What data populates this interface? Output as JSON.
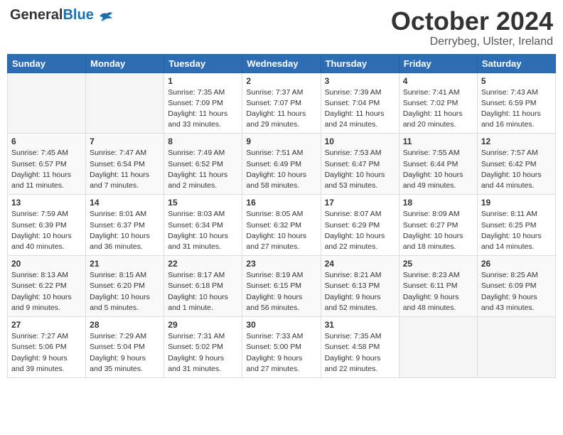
{
  "header": {
    "logo_general": "General",
    "logo_blue": "Blue",
    "title": "October 2024",
    "location": "Derrybeg, Ulster, Ireland"
  },
  "days_of_week": [
    "Sunday",
    "Monday",
    "Tuesday",
    "Wednesday",
    "Thursday",
    "Friday",
    "Saturday"
  ],
  "weeks": [
    [
      {
        "day": "",
        "sunrise": "",
        "sunset": "",
        "daylight": ""
      },
      {
        "day": "",
        "sunrise": "",
        "sunset": "",
        "daylight": ""
      },
      {
        "day": "1",
        "sunrise": "Sunrise: 7:35 AM",
        "sunset": "Sunset: 7:09 PM",
        "daylight": "Daylight: 11 hours and 33 minutes."
      },
      {
        "day": "2",
        "sunrise": "Sunrise: 7:37 AM",
        "sunset": "Sunset: 7:07 PM",
        "daylight": "Daylight: 11 hours and 29 minutes."
      },
      {
        "day": "3",
        "sunrise": "Sunrise: 7:39 AM",
        "sunset": "Sunset: 7:04 PM",
        "daylight": "Daylight: 11 hours and 24 minutes."
      },
      {
        "day": "4",
        "sunrise": "Sunrise: 7:41 AM",
        "sunset": "Sunset: 7:02 PM",
        "daylight": "Daylight: 11 hours and 20 minutes."
      },
      {
        "day": "5",
        "sunrise": "Sunrise: 7:43 AM",
        "sunset": "Sunset: 6:59 PM",
        "daylight": "Daylight: 11 hours and 16 minutes."
      }
    ],
    [
      {
        "day": "6",
        "sunrise": "Sunrise: 7:45 AM",
        "sunset": "Sunset: 6:57 PM",
        "daylight": "Daylight: 11 hours and 11 minutes."
      },
      {
        "day": "7",
        "sunrise": "Sunrise: 7:47 AM",
        "sunset": "Sunset: 6:54 PM",
        "daylight": "Daylight: 11 hours and 7 minutes."
      },
      {
        "day": "8",
        "sunrise": "Sunrise: 7:49 AM",
        "sunset": "Sunset: 6:52 PM",
        "daylight": "Daylight: 11 hours and 2 minutes."
      },
      {
        "day": "9",
        "sunrise": "Sunrise: 7:51 AM",
        "sunset": "Sunset: 6:49 PM",
        "daylight": "Daylight: 10 hours and 58 minutes."
      },
      {
        "day": "10",
        "sunrise": "Sunrise: 7:53 AM",
        "sunset": "Sunset: 6:47 PM",
        "daylight": "Daylight: 10 hours and 53 minutes."
      },
      {
        "day": "11",
        "sunrise": "Sunrise: 7:55 AM",
        "sunset": "Sunset: 6:44 PM",
        "daylight": "Daylight: 10 hours and 49 minutes."
      },
      {
        "day": "12",
        "sunrise": "Sunrise: 7:57 AM",
        "sunset": "Sunset: 6:42 PM",
        "daylight": "Daylight: 10 hours and 44 minutes."
      }
    ],
    [
      {
        "day": "13",
        "sunrise": "Sunrise: 7:59 AM",
        "sunset": "Sunset: 6:39 PM",
        "daylight": "Daylight: 10 hours and 40 minutes."
      },
      {
        "day": "14",
        "sunrise": "Sunrise: 8:01 AM",
        "sunset": "Sunset: 6:37 PM",
        "daylight": "Daylight: 10 hours and 36 minutes."
      },
      {
        "day": "15",
        "sunrise": "Sunrise: 8:03 AM",
        "sunset": "Sunset: 6:34 PM",
        "daylight": "Daylight: 10 hours and 31 minutes."
      },
      {
        "day": "16",
        "sunrise": "Sunrise: 8:05 AM",
        "sunset": "Sunset: 6:32 PM",
        "daylight": "Daylight: 10 hours and 27 minutes."
      },
      {
        "day": "17",
        "sunrise": "Sunrise: 8:07 AM",
        "sunset": "Sunset: 6:29 PM",
        "daylight": "Daylight: 10 hours and 22 minutes."
      },
      {
        "day": "18",
        "sunrise": "Sunrise: 8:09 AM",
        "sunset": "Sunset: 6:27 PM",
        "daylight": "Daylight: 10 hours and 18 minutes."
      },
      {
        "day": "19",
        "sunrise": "Sunrise: 8:11 AM",
        "sunset": "Sunset: 6:25 PM",
        "daylight": "Daylight: 10 hours and 14 minutes."
      }
    ],
    [
      {
        "day": "20",
        "sunrise": "Sunrise: 8:13 AM",
        "sunset": "Sunset: 6:22 PM",
        "daylight": "Daylight: 10 hours and 9 minutes."
      },
      {
        "day": "21",
        "sunrise": "Sunrise: 8:15 AM",
        "sunset": "Sunset: 6:20 PM",
        "daylight": "Daylight: 10 hours and 5 minutes."
      },
      {
        "day": "22",
        "sunrise": "Sunrise: 8:17 AM",
        "sunset": "Sunset: 6:18 PM",
        "daylight": "Daylight: 10 hours and 1 minute."
      },
      {
        "day": "23",
        "sunrise": "Sunrise: 8:19 AM",
        "sunset": "Sunset: 6:15 PM",
        "daylight": "Daylight: 9 hours and 56 minutes."
      },
      {
        "day": "24",
        "sunrise": "Sunrise: 8:21 AM",
        "sunset": "Sunset: 6:13 PM",
        "daylight": "Daylight: 9 hours and 52 minutes."
      },
      {
        "day": "25",
        "sunrise": "Sunrise: 8:23 AM",
        "sunset": "Sunset: 6:11 PM",
        "daylight": "Daylight: 9 hours and 48 minutes."
      },
      {
        "day": "26",
        "sunrise": "Sunrise: 8:25 AM",
        "sunset": "Sunset: 6:09 PM",
        "daylight": "Daylight: 9 hours and 43 minutes."
      }
    ],
    [
      {
        "day": "27",
        "sunrise": "Sunrise: 7:27 AM",
        "sunset": "Sunset: 5:06 PM",
        "daylight": "Daylight: 9 hours and 39 minutes."
      },
      {
        "day": "28",
        "sunrise": "Sunrise: 7:29 AM",
        "sunset": "Sunset: 5:04 PM",
        "daylight": "Daylight: 9 hours and 35 minutes."
      },
      {
        "day": "29",
        "sunrise": "Sunrise: 7:31 AM",
        "sunset": "Sunset: 5:02 PM",
        "daylight": "Daylight: 9 hours and 31 minutes."
      },
      {
        "day": "30",
        "sunrise": "Sunrise: 7:33 AM",
        "sunset": "Sunset: 5:00 PM",
        "daylight": "Daylight: 9 hours and 27 minutes."
      },
      {
        "day": "31",
        "sunrise": "Sunrise: 7:35 AM",
        "sunset": "Sunset: 4:58 PM",
        "daylight": "Daylight: 9 hours and 22 minutes."
      },
      {
        "day": "",
        "sunrise": "",
        "sunset": "",
        "daylight": ""
      },
      {
        "day": "",
        "sunrise": "",
        "sunset": "",
        "daylight": ""
      }
    ]
  ]
}
